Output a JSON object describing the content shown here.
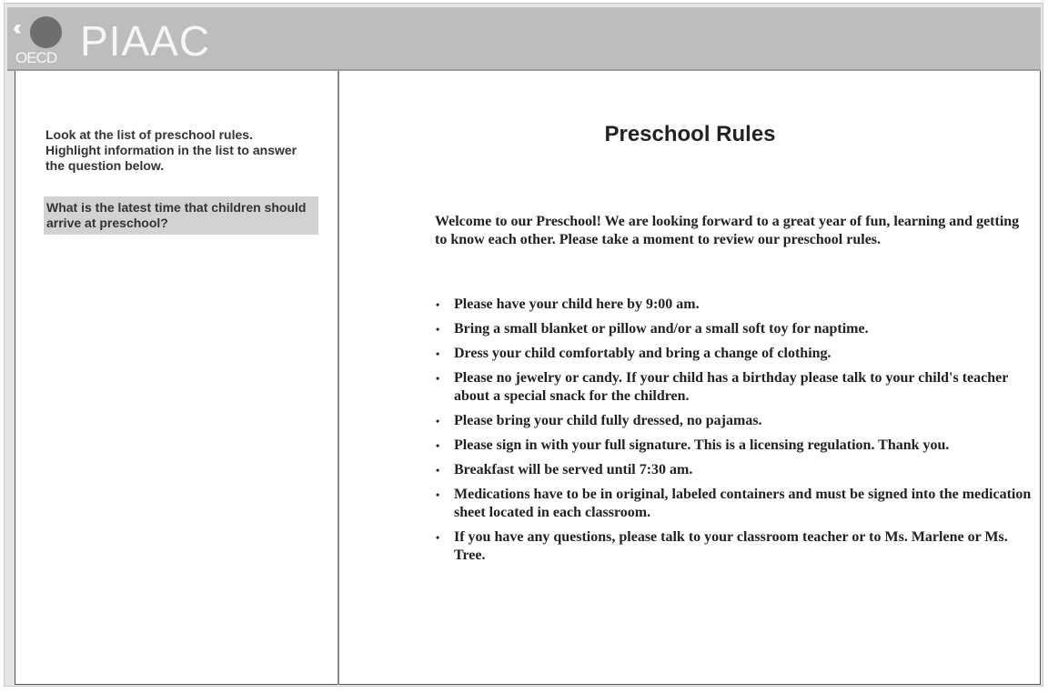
{
  "header": {
    "logo_text": "OECD",
    "app_title": "PIAAC"
  },
  "left_panel": {
    "instruction": "Look at the list of preschool rules. Highlight information in the list to answer the question below.",
    "question": "What is the latest time that children should arrive at preschool?"
  },
  "document": {
    "title": "Preschool Rules",
    "intro": "Welcome to our Preschool! We are looking forward to a great year of fun, learning and getting to know each other. Please take a moment to review our preschool rules.",
    "bullet_glyph": "•",
    "rules": [
      "Please have your child here by 9:00 am.",
      "Bring a small blanket or pillow and/or a small soft toy for naptime.",
      "Dress your child comfortably and bring a change of clothing.",
      "Please no jewelry or candy. If your child has a birthday please talk to your child's teacher about a special snack for the children.",
      "Please bring your child fully dressed, no pajamas.",
      "Please sign in with your full signature. This is a licensing regulation. Thank you.",
      "Breakfast will be served until 7:30 am.",
      "Medications have to be in original, labeled containers and must be signed into the medication sheet located in each classroom.",
      "If you have any questions, please talk to your classroom teacher or to Ms. Marlene or Ms. Tree."
    ]
  },
  "icons": {
    "logo": "oecd-logo-icon",
    "bullet": "bullet-icon"
  },
  "colors": {
    "header_bg": "#bdbdbd",
    "highlight_bg": "#d2d2d2",
    "text": "#222222"
  }
}
